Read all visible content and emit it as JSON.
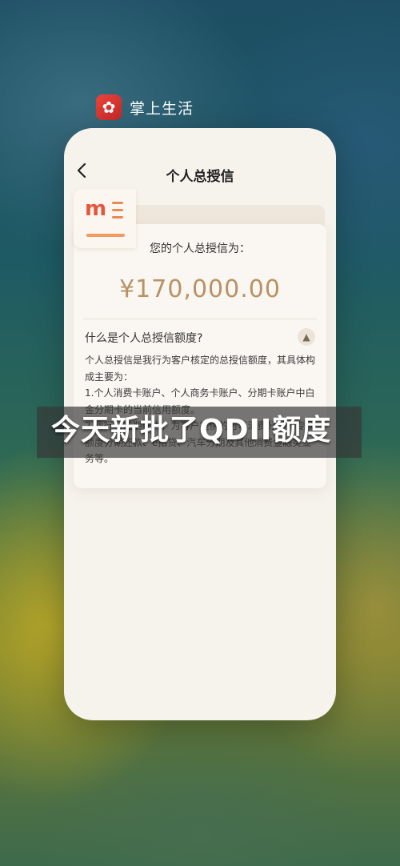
{
  "app": {
    "name": "掌上生活",
    "icon": "flower-icon",
    "icon_glyph": "✿",
    "icon_color": "#d32f2f"
  },
  "screen": {
    "title": "个人总授信",
    "back_icon": "chevron-left-icon"
  },
  "credit": {
    "label": "您的个人总授信为：",
    "amount": "¥170,000.00",
    "amount_color": "#b89165"
  },
  "faq": {
    "question": "什么是个人总授信额度?",
    "expand_icon": "chevron-up-icon",
    "answer_lines": [
      "个人总授信是我行为客户核定的总授信额度，其具体构成主要为：",
      "1.个人消费卡账户、个人商务卡账户、分期卡账户中白金分期卡的当前信用额度。",
      "2.我行一定期限内，为客户提供的可享消费分期的专项额度分期还款、e招贷、汽车分期及其他消费金融类业务等。"
    ]
  },
  "overlay": {
    "caption": "今天新批了QDII额度"
  }
}
